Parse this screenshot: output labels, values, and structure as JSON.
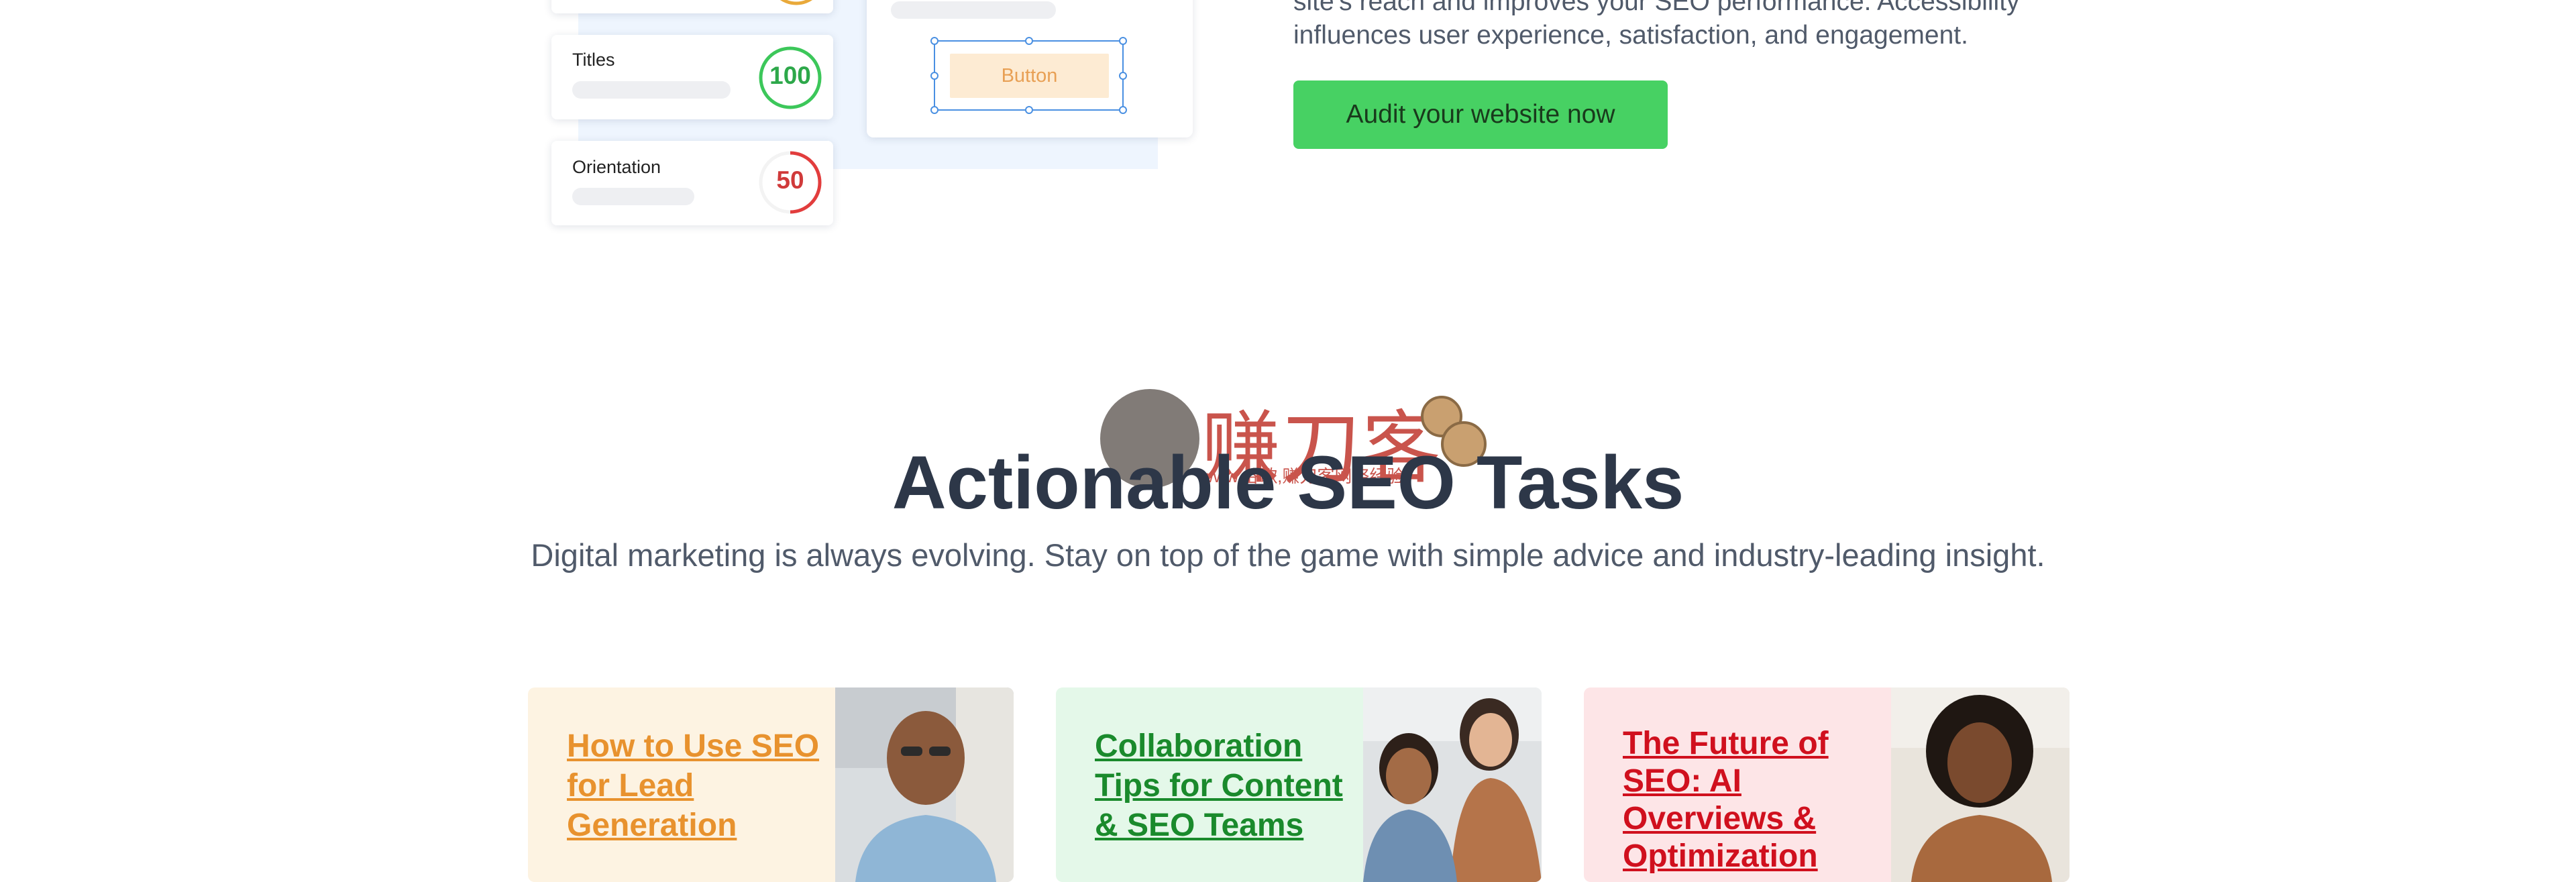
{
  "illustration": {
    "cards": [
      {
        "label": "Titles",
        "score": "100",
        "color": "#3cc75a"
      },
      {
        "label": "Orientation",
        "score": "50",
        "color": "#e23d3d"
      }
    ],
    "demo_button_label": "Button"
  },
  "intro": {
    "paragraph": "site's reach and improves your SEO performance. Accessibility influences user experience, satisfaction, and engagement.",
    "cta_label": "Audit your website now"
  },
  "watermark": {
    "brand": "赚刀客",
    "tagline": "www.谷歌,赚刀客网络经验"
  },
  "section": {
    "title": "Actionable SEO Tasks",
    "subtitle": "Digital marketing is always evolving. Stay on top of the game with simple advice and industry-leading insight."
  },
  "articles": [
    {
      "title": "How to Use SEO for Lead Generation",
      "bg": "#fdf3e2",
      "color": "#e8922e"
    },
    {
      "title": "Collaboration Tips for Content & SEO Teams",
      "bg": "#e4f8e9",
      "color": "#1a8a2c"
    },
    {
      "title": "The Future of SEO: AI Overviews & Optimization",
      "bg": "#fde5e7",
      "color": "#d0101e"
    }
  ],
  "colors": {
    "accent_green": "#47d163",
    "heading": "#2d3748",
    "body": "#505a6a"
  }
}
